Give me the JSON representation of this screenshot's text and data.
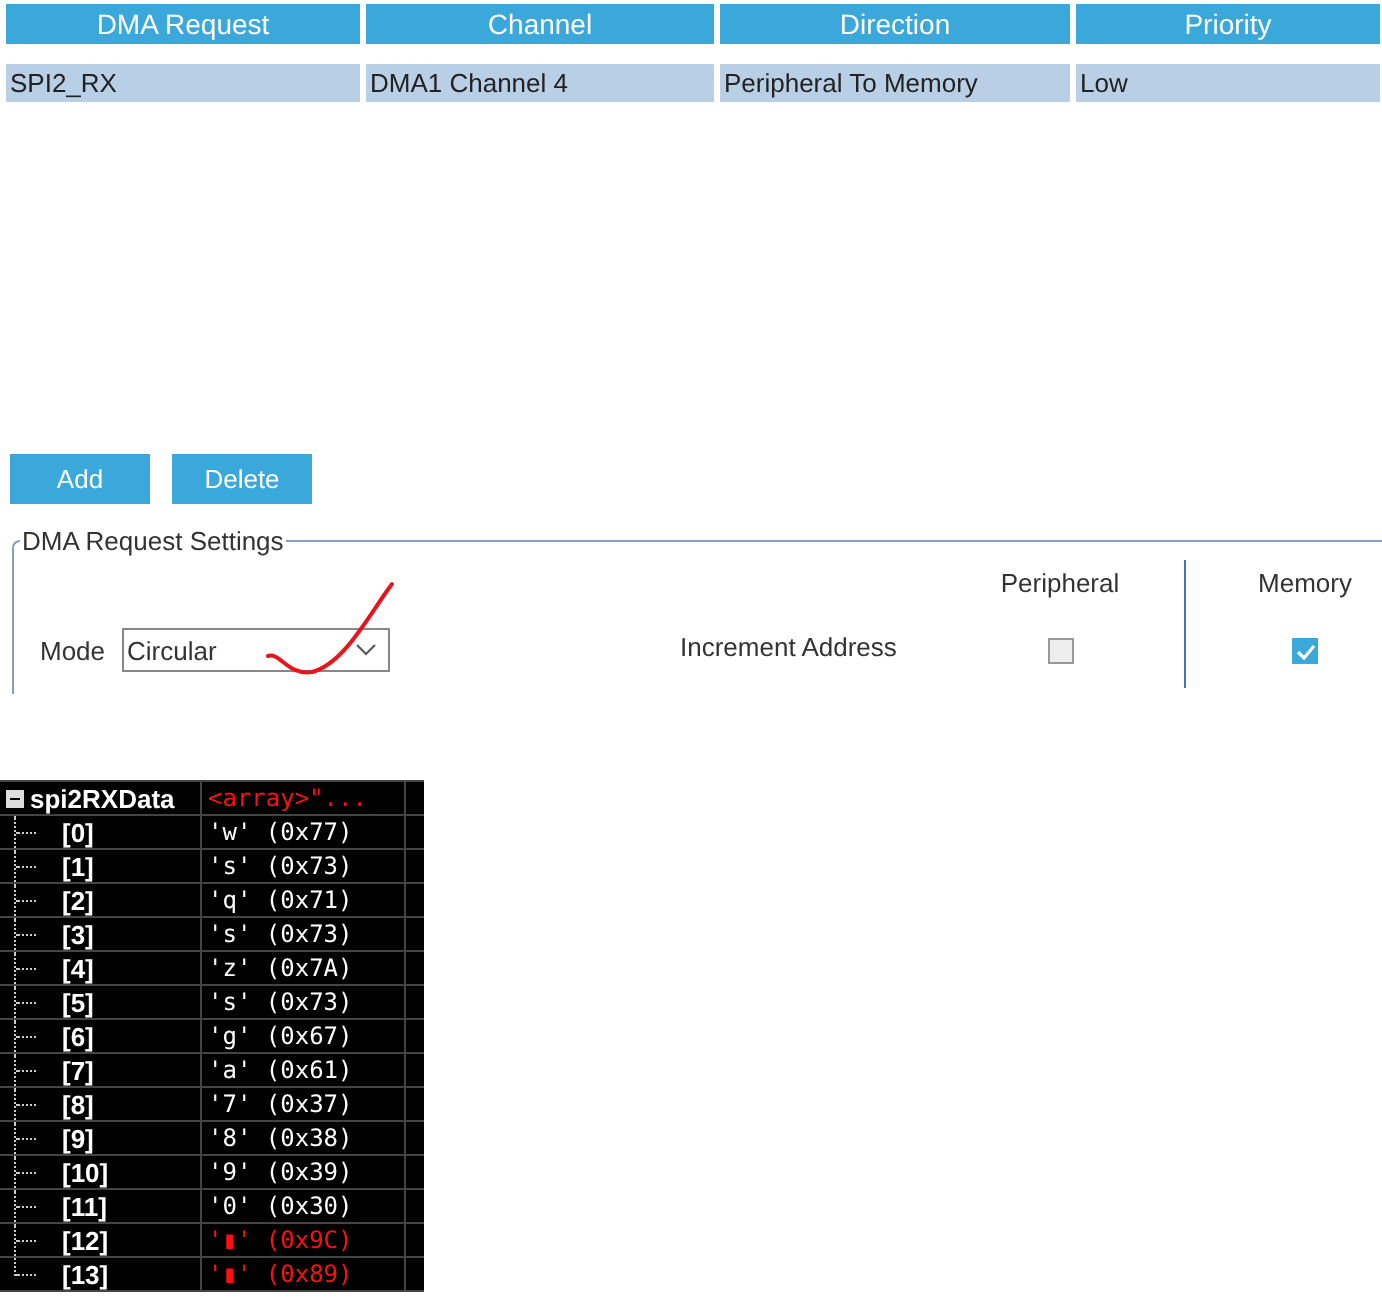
{
  "dma_table": {
    "columns": [
      "DMA Request",
      "Channel",
      "Direction",
      "Priority"
    ],
    "rows": [
      {
        "cells": [
          "SPI2_RX",
          "DMA1 Channel 4",
          "Peripheral To Memory",
          "Low"
        ],
        "selected": true
      }
    ]
  },
  "buttons": [
    "Add",
    "Delete"
  ],
  "settings": {
    "title": "DMA Request Settings",
    "mode_label": "Mode",
    "mode_value": "Circular",
    "increment_label": "Increment Address",
    "options": [
      {
        "label": "Peripheral",
        "checked": false
      },
      {
        "label": "Memory",
        "checked": true
      }
    ]
  },
  "watch": {
    "name": "spi2RXData",
    "value": "<array>\"...",
    "expanded": true,
    "changed": true,
    "children": [
      {
        "name": "[0]",
        "value": "'w' (0x77)",
        "changed": false
      },
      {
        "name": "[1]",
        "value": "'s' (0x73)",
        "changed": false
      },
      {
        "name": "[2]",
        "value": "'q' (0x71)",
        "changed": false
      },
      {
        "name": "[3]",
        "value": "'s' (0x73)",
        "changed": false
      },
      {
        "name": "[4]",
        "value": "'z' (0x7A)",
        "changed": false
      },
      {
        "name": "[5]",
        "value": "'s' (0x73)",
        "changed": false
      },
      {
        "name": "[6]",
        "value": "'g' (0x67)",
        "changed": false
      },
      {
        "name": "[7]",
        "value": "'a' (0x61)",
        "changed": false
      },
      {
        "name": "[8]",
        "value": "'7' (0x37)",
        "changed": false
      },
      {
        "name": "[9]",
        "value": "'8' (0x38)",
        "changed": false
      },
      {
        "name": "[10]",
        "value": "'9' (0x39)",
        "changed": false
      },
      {
        "name": "[11]",
        "value": "'0' (0x30)",
        "changed": false
      },
      {
        "name": "[12]",
        "value": "'▮' (0x9C)",
        "changed": true
      },
      {
        "name": "[13]",
        "value": "'▮' (0x89)",
        "changed": true
      }
    ]
  }
}
